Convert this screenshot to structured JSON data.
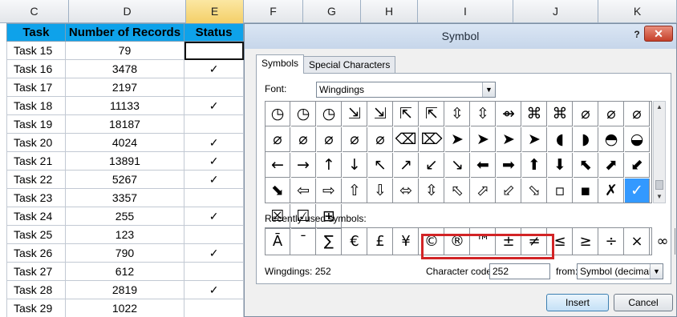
{
  "columns": [
    "C",
    "D",
    "E",
    "F",
    "G",
    "H",
    "I",
    "J",
    "K"
  ],
  "sheet": {
    "headers": [
      "Task",
      "Number of Records",
      "Status"
    ],
    "rows": [
      {
        "task": "Task 15",
        "records": "79",
        "status": ""
      },
      {
        "task": "Task 16",
        "records": "3478",
        "status": "✓"
      },
      {
        "task": "Task 17",
        "records": "2197",
        "status": ""
      },
      {
        "task": "Task 18",
        "records": "11133",
        "status": "✓"
      },
      {
        "task": "Task 19",
        "records": "18187",
        "status": ""
      },
      {
        "task": "Task 20",
        "records": "4024",
        "status": "✓"
      },
      {
        "task": "Task 21",
        "records": "13891",
        "status": "✓"
      },
      {
        "task": "Task 22",
        "records": "5267",
        "status": "✓"
      },
      {
        "task": "Task 23",
        "records": "3357",
        "status": ""
      },
      {
        "task": "Task 24",
        "records": "255",
        "status": "✓"
      },
      {
        "task": "Task 25",
        "records": "123",
        "status": ""
      },
      {
        "task": "Task 26",
        "records": "790",
        "status": "✓"
      },
      {
        "task": "Task 27",
        "records": "612",
        "status": ""
      },
      {
        "task": "Task 28",
        "records": "2819",
        "status": "✓"
      },
      {
        "task": "Task 29",
        "records": "1022",
        "status": ""
      }
    ]
  },
  "dialog": {
    "title": "Symbol",
    "help": "?",
    "close": "✕",
    "tabs": [
      "Symbols",
      "Special Characters"
    ],
    "font_label": "Font:",
    "font_value": "Wingdings",
    "recent_label": "Recently used symbols:",
    "status_text": "Wingdings: 252",
    "charcode_label": "Character code:",
    "charcode_value": "252",
    "from_label": "from:",
    "from_value": "Symbol (decimal)",
    "insert_label": "Insert",
    "cancel_label": "Cancel",
    "symbols": [
      "◷",
      "◷",
      "◷",
      "⇲",
      "⇲",
      "⇱",
      "⇱",
      "⇳",
      "⇳",
      "⇴",
      "⌘",
      "⌘",
      "⌀",
      "⌀",
      "⌀",
      "⌀",
      "⌀",
      "⌀",
      "⌀",
      "⌀",
      "⌫",
      "⌦",
      "➤",
      "➤",
      "➤",
      "➤",
      "◖",
      "◗",
      "◓",
      "◒",
      "←",
      "→",
      "↑",
      "↓",
      "↖",
      "↗",
      "↙",
      "↘",
      "⬅",
      "➡",
      "⬆",
      "⬇",
      "⬉",
      "⬈",
      "⬋",
      "⬊",
      "⇦",
      "⇨",
      "⇧",
      "⇩",
      "⬄",
      "⇳",
      "⬁",
      "⬀",
      "⬃",
      "⬂",
      "▫",
      "▪",
      "✗",
      "✓",
      "☒",
      "☑",
      "⊞"
    ],
    "selected_index": 59,
    "recent": [
      "Ā",
      "¯",
      "∑",
      "€",
      "£",
      "¥",
      "©",
      "®",
      "™",
      "±",
      "≠",
      "≤",
      "≥",
      "÷",
      "×",
      "∞"
    ]
  }
}
